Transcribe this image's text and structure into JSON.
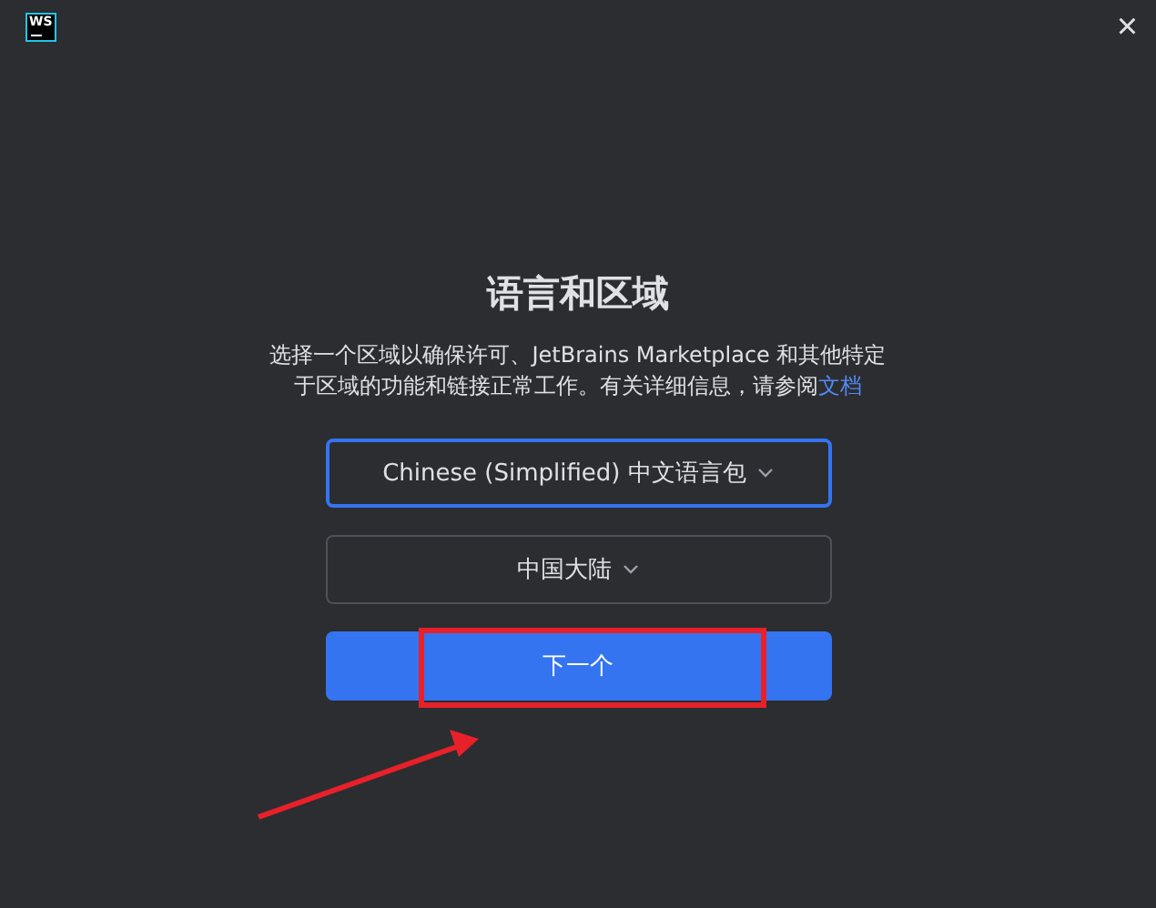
{
  "window": {
    "logo": "WS",
    "close": "×"
  },
  "title": "语言和区域",
  "description": {
    "text": "选择一个区域以确保许可、JetBrains Marketplace 和其他特定于区域的功能和链接正常工作。有关详细信息，请参阅",
    "link": "文档"
  },
  "dropdowns": [
    {
      "value": "Chinese (Simplified) 中文语言包",
      "focused": true
    },
    {
      "value": "中国大陆",
      "focused": false
    }
  ],
  "next_button": "下一个",
  "annotations": {
    "highlight_box": true,
    "pointer_arrow": true
  }
}
